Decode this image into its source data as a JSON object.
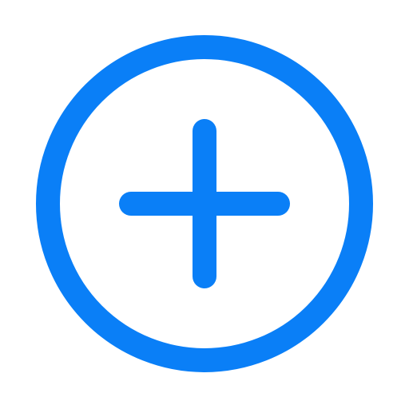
{
  "icon": {
    "name": "plus-circle-icon",
    "color": "#0A7FF7",
    "background": "#FFFFFF"
  }
}
